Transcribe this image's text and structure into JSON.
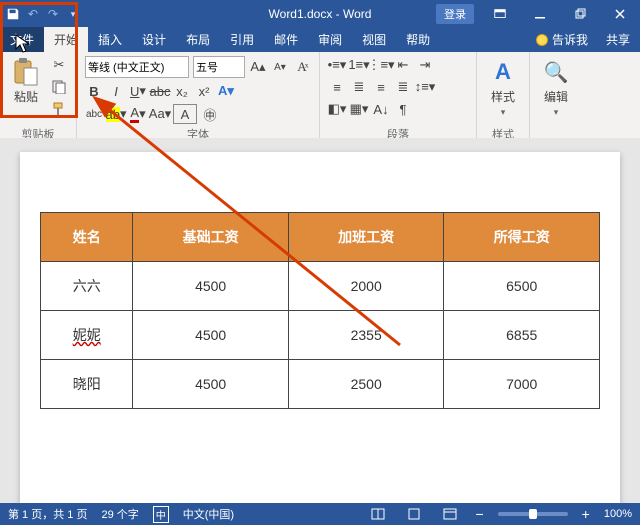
{
  "titlebar": {
    "doc_title": "Word1.docx - Word",
    "login": "登录"
  },
  "tabs": {
    "file": "文件",
    "home": "开始",
    "insert": "插入",
    "design": "设计",
    "layout": "布局",
    "references": "引用",
    "mailings": "邮件",
    "review": "审阅",
    "view": "视图",
    "help": "帮助",
    "tellme": "告诉我",
    "share": "共享"
  },
  "ribbon": {
    "clipboard": {
      "label": "剪贴板",
      "paste": "粘贴"
    },
    "font": {
      "label": "字体",
      "fontname": "等线 (中文正文)",
      "fontsize": "五号"
    },
    "paragraph": {
      "label": "段落"
    },
    "styles": {
      "label": "样式",
      "button": "样式"
    },
    "editing": {
      "label": "编辑"
    }
  },
  "table": {
    "headers": [
      "姓名",
      "基础工资",
      "加班工资",
      "所得工资"
    ],
    "rows": [
      [
        "六六",
        "4500",
        "2000",
        "6500"
      ],
      [
        "妮妮",
        "4500",
        "2355",
        "6855"
      ],
      [
        "晓阳",
        "4500",
        "2500",
        "7000"
      ]
    ]
  },
  "status": {
    "page": "第 1 页，共 1 页",
    "words": "29 个字",
    "lang_icon": "中",
    "lang": "中文(中国)",
    "zoom_minus": "−",
    "zoom_plus": "+",
    "zoom": "100%"
  }
}
